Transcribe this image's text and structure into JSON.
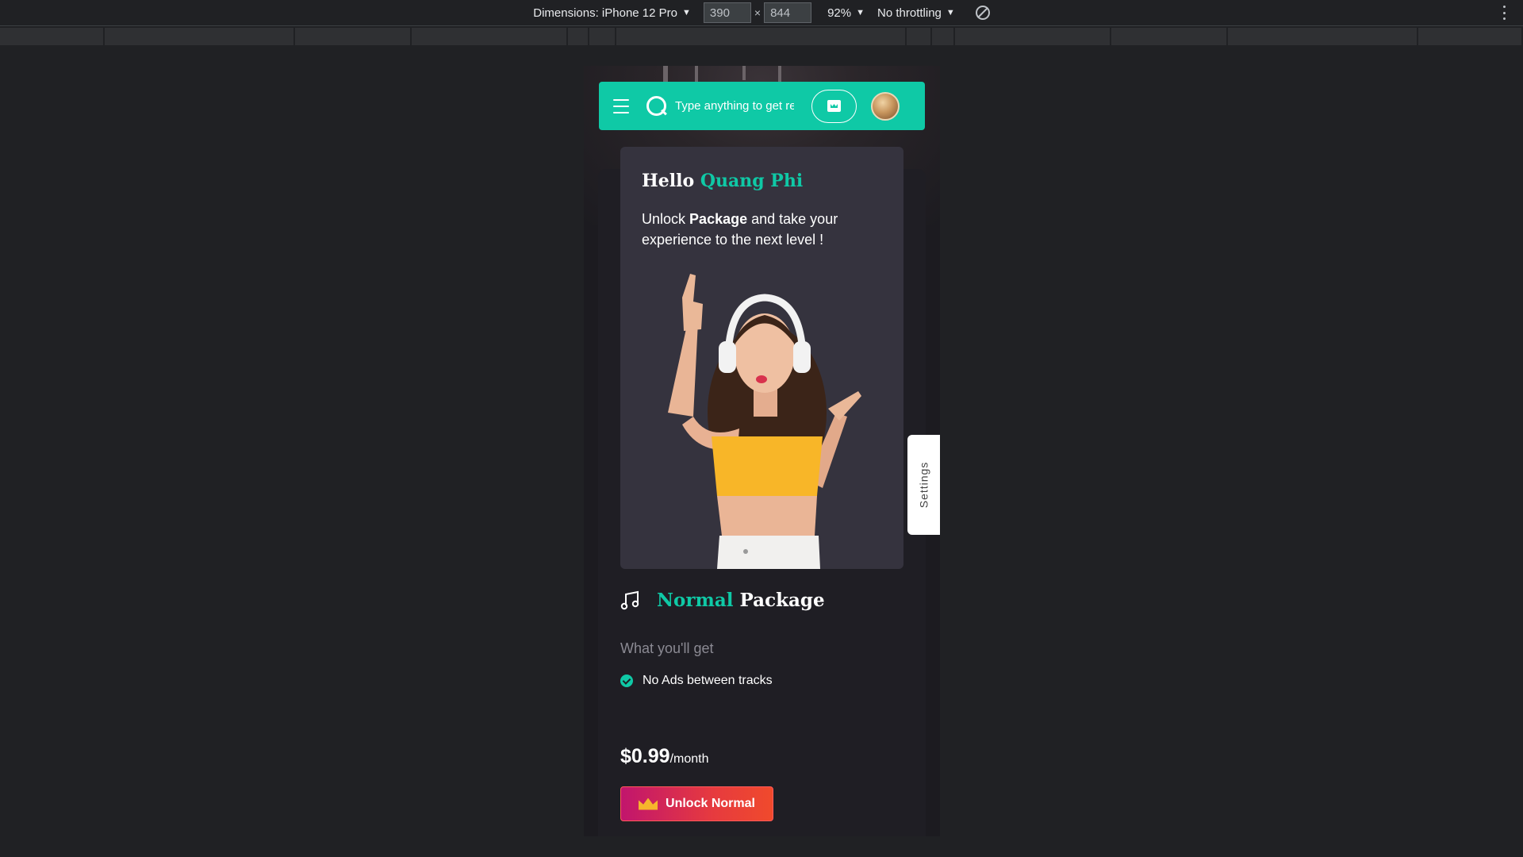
{
  "devtools": {
    "dimensions_label": "Dimensions: iPhone 12 Pro",
    "width_value": "390",
    "height_value": "844",
    "times": "×",
    "zoom": "92%",
    "throttling": "No throttling",
    "caret": "▼"
  },
  "app": {
    "search_placeholder": "Type anything to get result...",
    "greeting": "Hello",
    "user_name": "Quang Phi",
    "unlock_intro": "Unlock",
    "unlock_bold": "Package",
    "unlock_rest": "and take your experience to the next level !",
    "settings_label": "Settings",
    "package_accent": "Normal",
    "package_label": "Package",
    "what_label": "What you'll get",
    "features": [
      "No Ads between tracks"
    ],
    "price": "$0.99",
    "price_period": "/month",
    "cta_label": "Unlock Normal"
  },
  "colors": {
    "accent": "#0fc9a6",
    "card": "#35333e",
    "cta_gradient_start": "#c1156d",
    "cta_gradient_end": "#f04a2c"
  },
  "icons": [
    "menu-icon",
    "search-icon",
    "crown-icon",
    "avatar",
    "music-note-icon",
    "check-circle-icon",
    "rotate-icon",
    "more-vertical-icon"
  ]
}
